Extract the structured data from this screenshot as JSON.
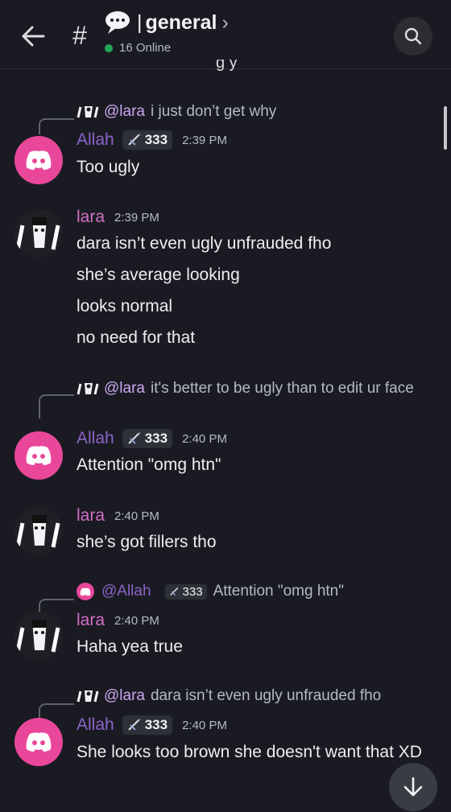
{
  "header": {
    "channel_name": "general",
    "separator": "|",
    "online_count": "16 Online",
    "chevron": "›",
    "hash": "#"
  },
  "colors": {
    "online": "#23a55a",
    "allah_name": "#8c63c9",
    "lara_name": "#d36fc8",
    "discord_pink": "#e9479a",
    "mention": "#c9a7f0"
  },
  "messages": [
    {
      "reply": {
        "mention": "@lara",
        "text": "i just don’t get why"
      },
      "author": "Allah",
      "badge": "333",
      "time": "2:39 PM",
      "lines": [
        "Too ugly"
      ]
    },
    {
      "author": "lara",
      "time": "2:39 PM",
      "lines": [
        "dara isn’t even ugly unfrauded fho",
        "she’s average looking",
        "looks normal",
        "no need for that"
      ]
    },
    {
      "reply": {
        "mention": "@lara",
        "text": "it's better to be ugly than to edit ur face"
      },
      "author": "Allah",
      "badge": "333",
      "time": "2:40 PM",
      "lines": [
        "Attention \"omg htn\""
      ]
    },
    {
      "author": "lara",
      "time": "2:40 PM",
      "lines": [
        "she’s got fillers tho"
      ]
    },
    {
      "reply": {
        "mention": "@Allah",
        "badge": "333",
        "text": "Attention \"omg htn\""
      },
      "author": "lara",
      "time": "2:40 PM",
      "lines": [
        "Haha yea true"
      ]
    },
    {
      "reply": {
        "mention": "@lara",
        "text": "dara isn’t even ugly unfrauded fho"
      },
      "author": "Allah",
      "badge": "333",
      "time": "2:40 PM",
      "lines": [
        "She looks too brown she doesn't want that XD"
      ]
    }
  ]
}
